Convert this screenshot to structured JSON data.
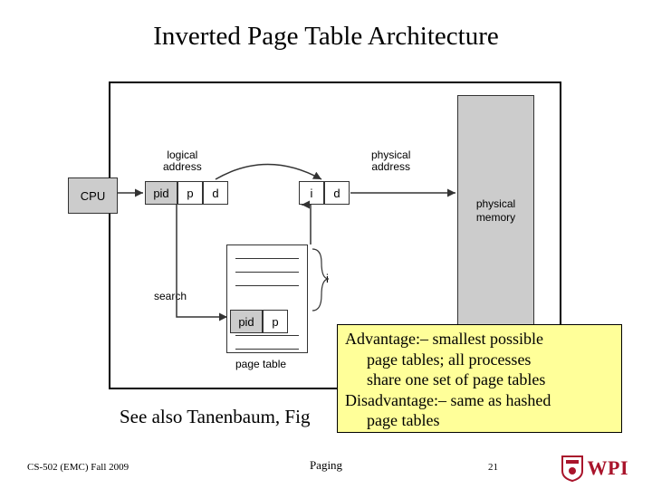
{
  "title": "Inverted Page Table Architecture",
  "diagram": {
    "cpu": "CPU",
    "logical_label": "logical\naddress",
    "physical_label": "physical\naddress",
    "search_label": "search",
    "pagetable_label": "page table",
    "i_label": "i",
    "pm_label": "physical\nmemory",
    "cells": {
      "pid1": "pid",
      "p1": "p",
      "d1": "d",
      "i2": "i",
      "d2": "d",
      "tbl_pid": "pid",
      "tbl_p": "p"
    }
  },
  "note": {
    "line1": "Advantage:– smallest possible",
    "line2": "page tables; all processes",
    "line3": "share one set of page tables",
    "line4": "Disadvantage:– same as hashed",
    "line5": "page tables"
  },
  "see_also": "See also Tanenbaum, Fig",
  "footer": {
    "left": "CS-502 (EMC) Fall 2009",
    "center": "Paging",
    "num": "21",
    "logo_text": "WPI"
  }
}
